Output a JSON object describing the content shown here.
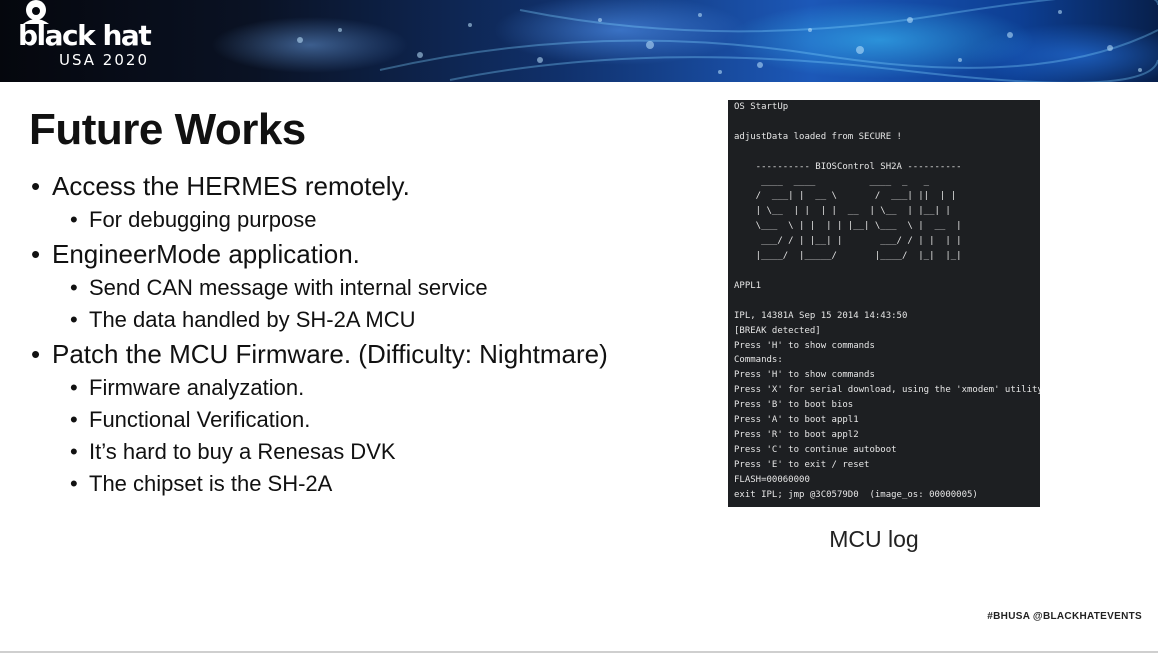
{
  "header": {
    "logo_word": "black hat",
    "logo_sub": "USA 2020"
  },
  "slide": {
    "title": "Future Works",
    "bullets": [
      {
        "text": "Access the HERMES remotely.",
        "sub": [
          "For debugging purpose"
        ]
      },
      {
        "text": "EngineerMode application.",
        "sub": [
          "Send CAN message with internal service",
          "The data handled by SH-2A MCU"
        ]
      },
      {
        "text": "Patch the MCU Firmware. (Difficulty: Nightmare)",
        "sub": [
          "Firmware analyzation.",
          "Functional Verification.",
          "It’s hard to buy a Renesas DVK",
          "The chipset is the SH-2A"
        ]
      }
    ]
  },
  "terminal": {
    "lines": [
      "OS StartUp",
      "",
      "adjustData loaded from SECURE !",
      "",
      "    ---------- BIOSControl SH2A ----------",
      "     ____  ____          ____  _   _",
      "    /  ___| |  __ \\       /  ___| ||  | |",
      "    | \\__  | |  | |  __  | \\__  | |__| |",
      "    \\___  \\ | |  | | |__| \\___  \\ |  __  |",
      "     ___/ / | |__| |       ___/ / | |  | |",
      "    |____/  |_____/       |____/  |_|  |_|",
      "",
      "APPL1",
      "",
      "IPL, 14381A Sep 15 2014 14:43:50",
      "[BREAK detected]",
      "Press 'H' to show commands",
      "Commands:",
      "Press 'H' to show commands",
      "Press 'X' for serial download, using the 'xmodem' utility",
      "Press 'B' to boot bios",
      "Press 'A' to boot appl1",
      "Press 'R' to boot appl2",
      "Press 'C' to continue autoboot",
      "Press 'E' to exit / reset",
      "FLASH=00060000",
      "exit IPL; jmp @3C0579D0  (image_os: 00000005)"
    ]
  },
  "caption": "MCU log",
  "footer": {
    "tags": "#BHUSA   @BLACKHATEVENTS"
  },
  "icons": {
    "logo_icon": "spy-hat-icon",
    "bullet_glyph": "•"
  },
  "colors": {
    "banner_dark": "#05070d",
    "banner_blue": "#1c58b8",
    "terminal_bg": "#1d1f22",
    "text": "#111111"
  }
}
